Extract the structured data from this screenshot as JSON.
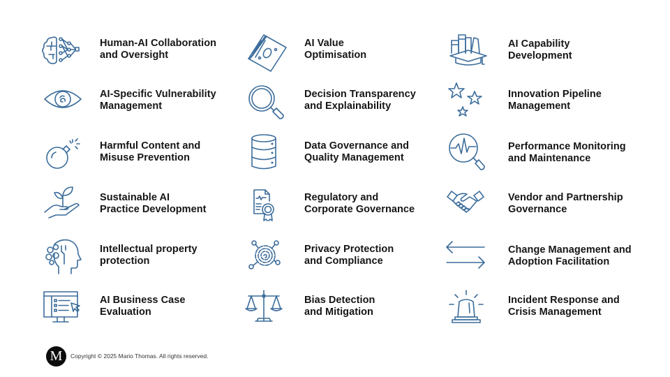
{
  "items": [
    {
      "icon": "brain-network-icon",
      "line1": "Human-AI Collaboration",
      "line2": "and Oversight"
    },
    {
      "icon": "money-bills-icon",
      "line1": "AI Value",
      "line2": "Optimisation"
    },
    {
      "icon": "books-graduation-cap-icon",
      "line1": "AI Capability",
      "line2": "Development"
    },
    {
      "icon": "eye-icon",
      "line1": "AI-Specific Vulnerability",
      "line2": "Management"
    },
    {
      "icon": "magnifying-glass-icon",
      "line1": "Decision Transparency",
      "line2": "and Explainability"
    },
    {
      "icon": "stars-icon",
      "line1": "Innovation Pipeline",
      "line2": "Management"
    },
    {
      "icon": "bomb-icon",
      "line1": "Harmful Content and",
      "line2": "Misuse Prevention"
    },
    {
      "icon": "database-icon",
      "line1": "Data Governance and",
      "line2": "Quality Management"
    },
    {
      "icon": "magnifier-pulse-icon",
      "line1": "Performance Monitoring",
      "line2": "and Maintenance"
    },
    {
      "icon": "hand-plant-icon",
      "line1": "Sustainable AI",
      "line2": "Practice Development"
    },
    {
      "icon": "certificate-document-icon",
      "line1": "Regulatory and",
      "line2": "Corporate Governance"
    },
    {
      "icon": "handshake-icon",
      "line1": "Vendor and Partnership",
      "line2": "Governance"
    },
    {
      "icon": "head-gears-icon",
      "line1": "Intellectual property",
      "line2": "protection"
    },
    {
      "icon": "fingerprint-network-icon",
      "line1": "Privacy Protection",
      "line2": "and Compliance"
    },
    {
      "icon": "exchange-arrows-icon",
      "line1": "Change Management and",
      "line2": "Adoption Facilitation"
    },
    {
      "icon": "monitor-checklist-cursor-icon",
      "line1": "AI Business Case",
      "line2": "Evaluation"
    },
    {
      "icon": "balance-scale-icon",
      "line1": "Bias Detection",
      "line2": "and Mitigation"
    },
    {
      "icon": "alarm-siren-icon",
      "line1": "Incident Response and",
      "line2": "Crisis Management"
    }
  ],
  "footer": {
    "logo_letter": "M",
    "copyright": "Copyright © 2025 Mario Thomas. All rights reserved."
  },
  "colors": {
    "icon_stroke": "#3b6c9a",
    "text": "#151515",
    "logo_bg": "#0c0c0c"
  }
}
